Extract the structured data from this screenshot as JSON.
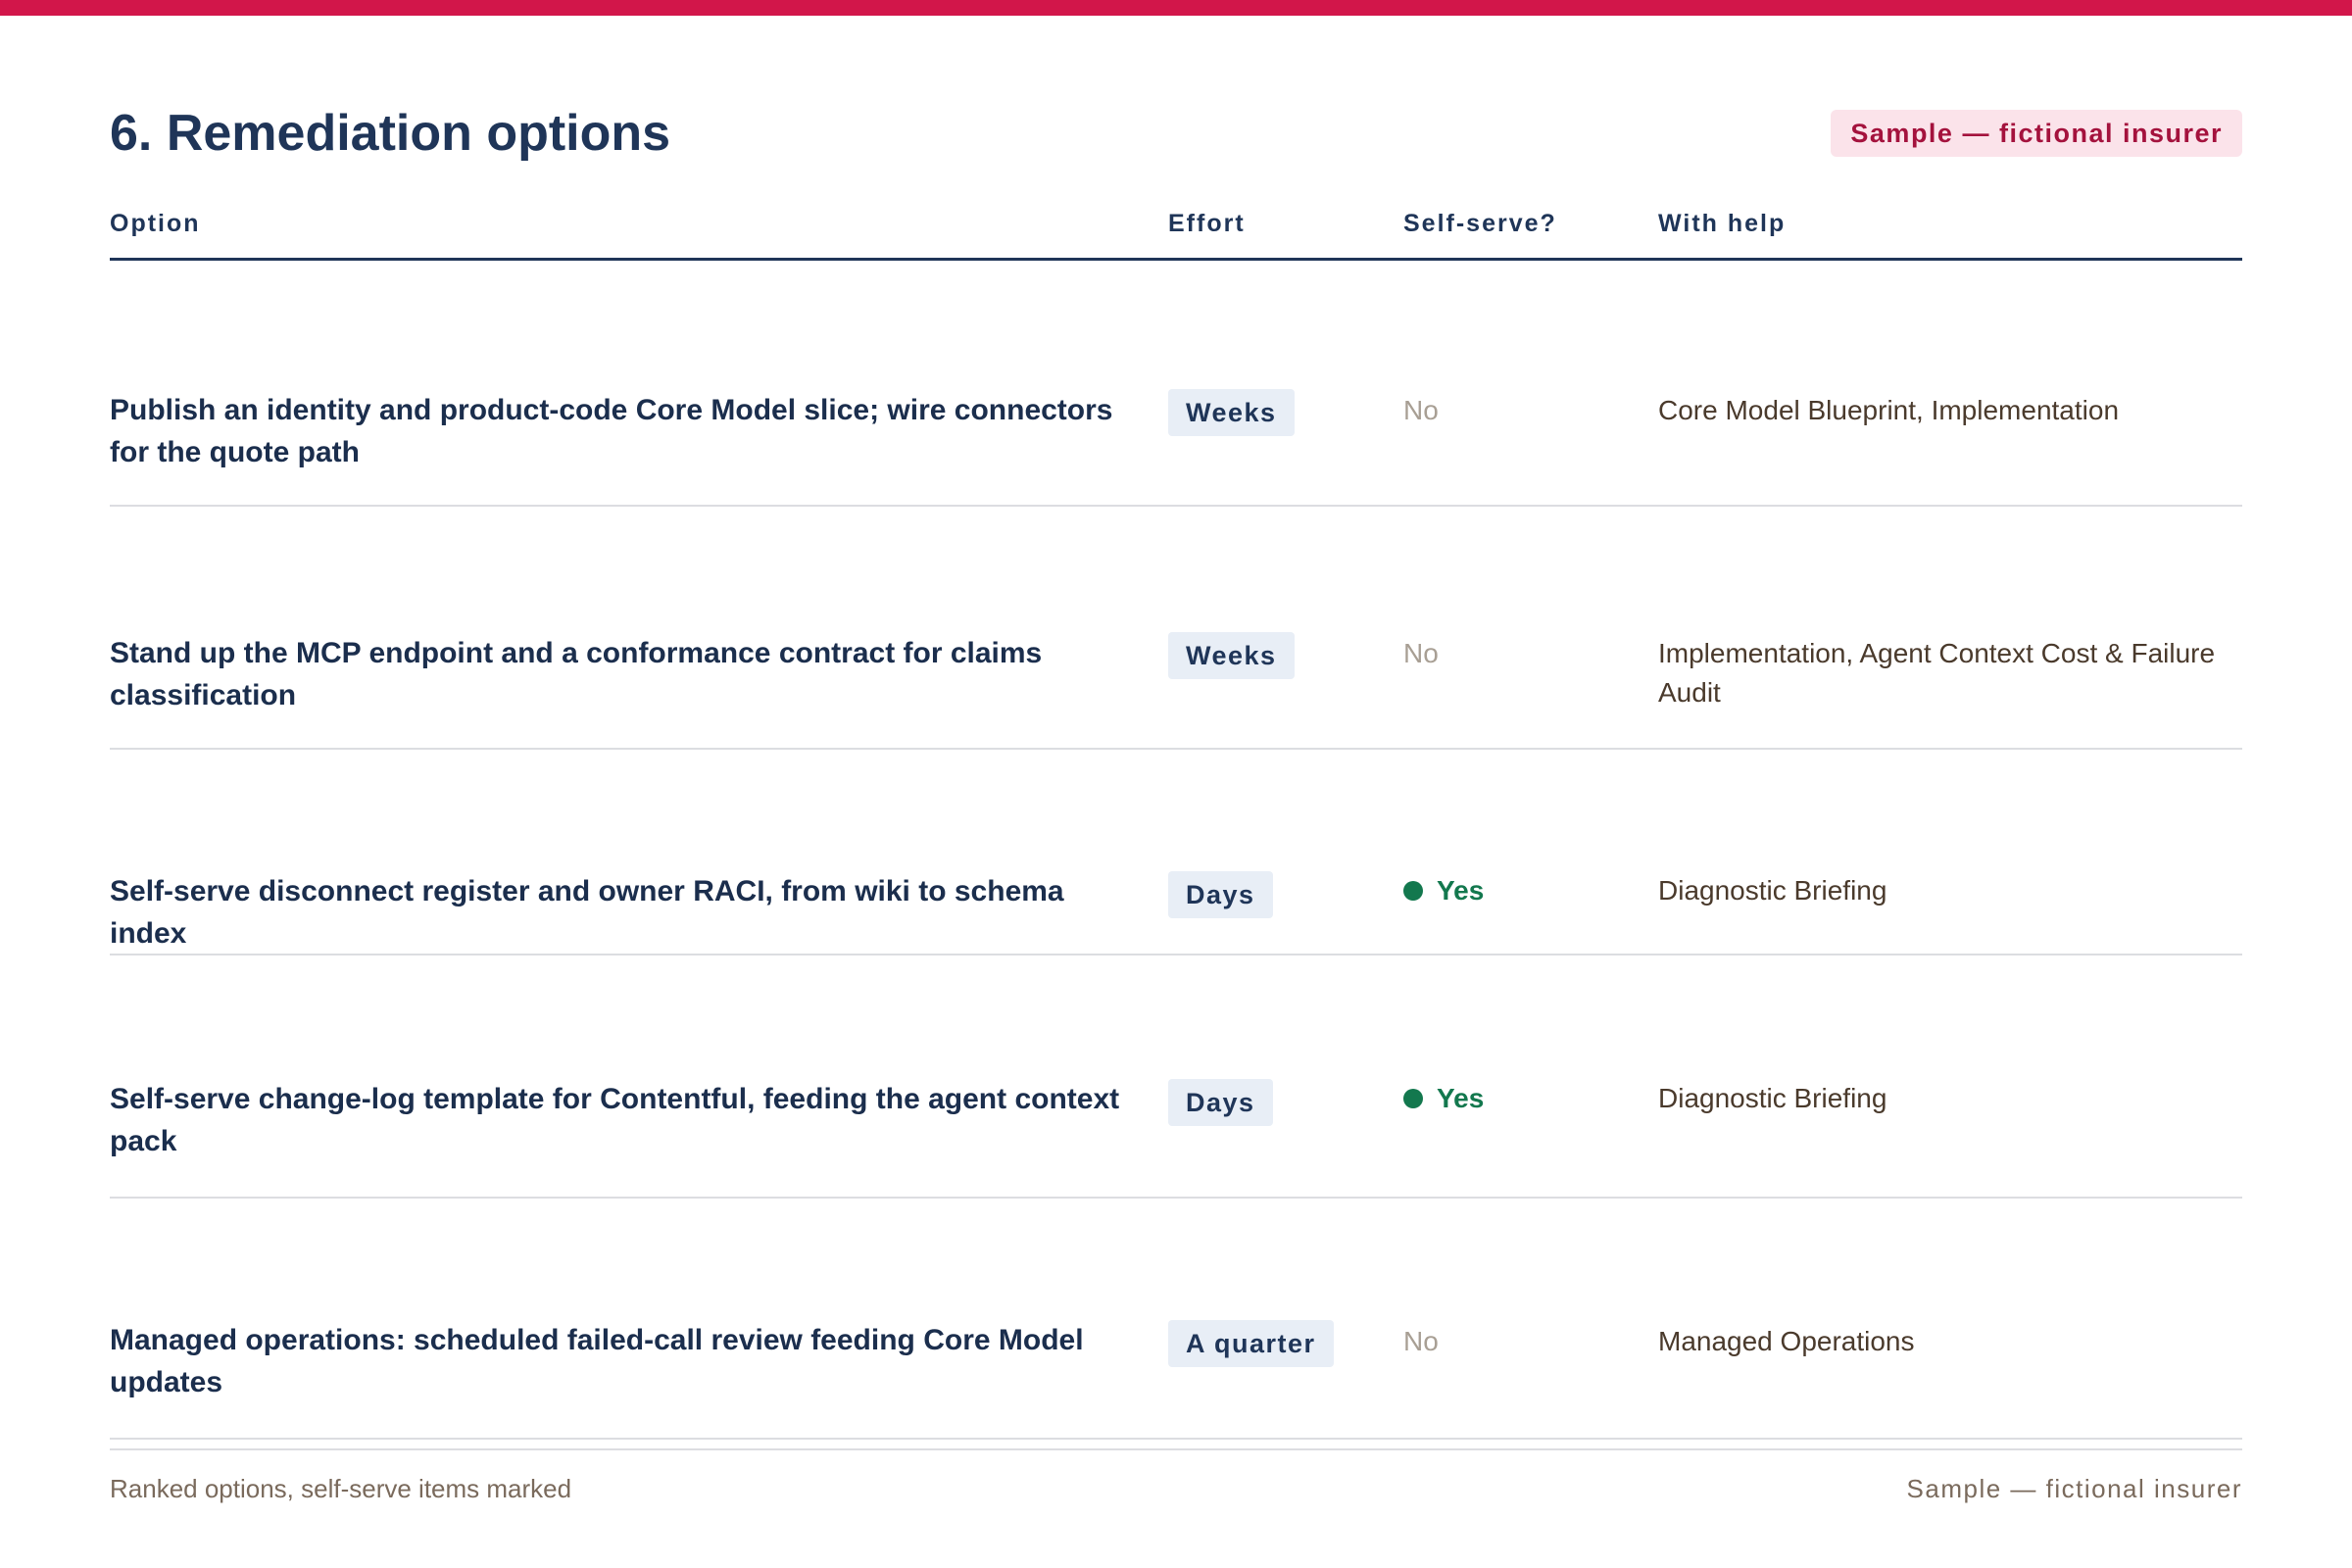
{
  "header": {
    "title": "6. Remediation options",
    "badge": "Sample — fictional insurer"
  },
  "table": {
    "columns": [
      "Option",
      "Effort",
      "Self-serve?",
      "With help"
    ],
    "rows": [
      {
        "option": "Publish an identity and product-code Core Model slice; wire connectors for the quote path",
        "effort": "Weeks",
        "self_serve": "No",
        "with_help": "Core Model Blueprint, Implementation"
      },
      {
        "option": "Stand up the MCP endpoint and a conformance contract for claims classification",
        "effort": "Weeks",
        "self_serve": "No",
        "with_help": "Implementation, Agent Context Cost & Failure Audit"
      },
      {
        "option": "Self-serve disconnect register and owner RACI, from wiki to schema index",
        "effort": "Days",
        "self_serve": "Yes",
        "with_help": "Diagnostic Briefing"
      },
      {
        "option": "Self-serve change-log template for Contentful, feeding the agent context pack",
        "effort": "Days",
        "self_serve": "Yes",
        "with_help": "Diagnostic Briefing"
      },
      {
        "option": "Managed operations: scheduled failed-call review feeding Core Model updates",
        "effort": "A quarter",
        "self_serve": "No",
        "with_help": "Managed Operations"
      }
    ]
  },
  "footer": {
    "left": "Ranked options, self-serve items marked",
    "right": "Sample — fictional insurer"
  },
  "colors": {
    "accent": "#d2164a",
    "navy": "#1f3558",
    "yes_green": "#13784e",
    "no_gray": "#a89f94"
  }
}
